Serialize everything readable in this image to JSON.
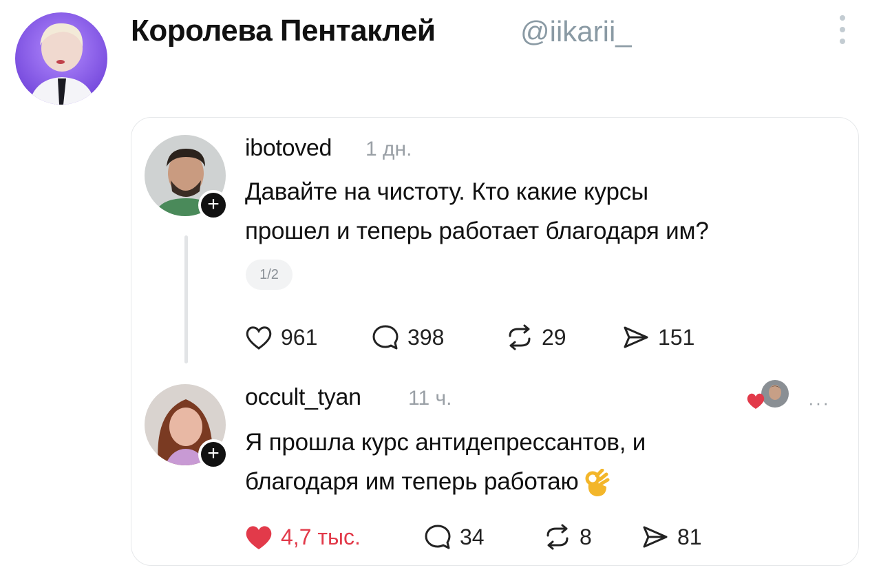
{
  "author": {
    "name": "Королева Пентаклей",
    "handle": "@iikarii_"
  },
  "quoted_post": {
    "username": "ibotoved",
    "time": "1 дн.",
    "text_line1": "Давайте на чистоту. Кто какие курсы",
    "text_line2": "прошел и теперь работает благодаря им?",
    "page_indicator": "1/2",
    "likes": "961",
    "replies": "398",
    "reposts": "29",
    "shares": "151"
  },
  "reply": {
    "username": "occult_tyan",
    "time": "11 ч.",
    "text_line1": "Я прошла курс антидепрессантов, и",
    "text_line2": "благодаря им теперь работаю",
    "likes": "4,7 тыс.",
    "replies": "34",
    "reposts": "8",
    "shares": "81",
    "more": "···"
  },
  "colors": {
    "liked": "#e23a4a",
    "muted": "#9aa0a6",
    "handle": "#8a9aa4"
  }
}
